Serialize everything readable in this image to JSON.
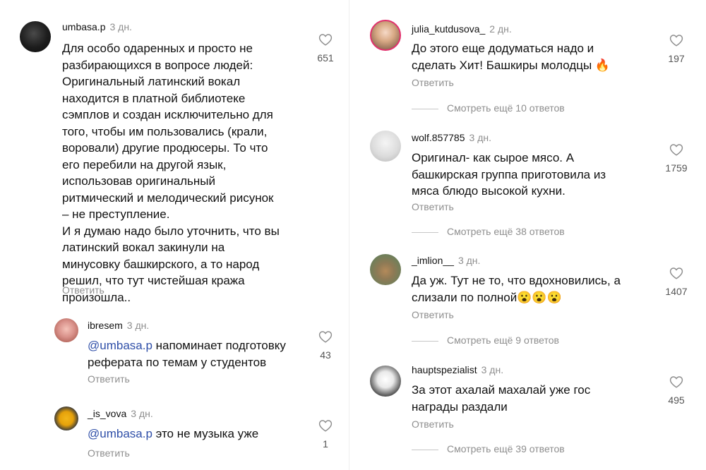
{
  "left": {
    "main": {
      "username": "umbasa.p",
      "time": "3 дн.",
      "lines": [
        "Для особо одаренных и просто не",
        "разбирающихся в вопросе людей:",
        "Оригинальный латинский вокал",
        "находится в платной библиотеке",
        "сэмплов и создан исключительно для",
        "того, чтобы им пользовались (крали,",
        "воровали) другие продюсеры. То что",
        "его перебили на другой язык,",
        "использовав оригинальный",
        "ритмический и мелодический рисунок",
        "– не преступление.",
        "И я думаю надо было уточнить, что вы",
        "латинский вокал закинули на",
        "минусовку башкирского, а то народ",
        "решил, что тут чистейшая кража",
        "произошла.."
      ],
      "reply_label": "Ответить",
      "likes": "651"
    },
    "reply1": {
      "username": "ibresem",
      "time": "3 дн.",
      "mention": "@umbasa.p",
      "line1_rest": " напоминает подготовку",
      "line2": "реферата по темам у студентов",
      "reply_label": "Ответить",
      "likes": "43"
    },
    "reply2": {
      "username": "_is_vova",
      "time": "3 дн.",
      "mention": "@umbasa.p",
      "line1_rest": " это не музыка уже",
      "reply_label": "Ответить",
      "likes": "1"
    }
  },
  "right": {
    "c1": {
      "username": "julia_kutdusova_",
      "time": "2 дн.",
      "line1": "До этого еще додуматься надо и",
      "line2": "сделать Хит! Башкиры молодцы 🔥",
      "reply_label": "Ответить",
      "likes": "197",
      "more": "Смотреть ещё 10 ответов"
    },
    "c2": {
      "username": "wolf.857785",
      "time": "3 дн.",
      "line1": "Оригинал- как сырое мясо. А",
      "line2": "башкирская  группа приготовила из",
      "line3": "мяса блюдо высокой кухни.",
      "reply_label": "Ответить",
      "likes": "1759",
      "more": "Смотреть ещё 38 ответов"
    },
    "c3": {
      "username": "_imlion__",
      "time": "3 дн.",
      "line1": "Да уж. Тут не то, что вдохновились, а",
      "line2": "слизали по полной😮😮😮",
      "reply_label": "Ответить",
      "likes": "1407",
      "more": "Смотреть ещё 9 ответов"
    },
    "c4": {
      "username": "hauptspezialist",
      "time": "3 дн.",
      "line1": "За этот ахалай махалай уже гос",
      "line2": "награды раздали",
      "reply_label": "Ответить",
      "likes": "495",
      "more": "Смотреть ещё 39 ответов"
    }
  },
  "icons": {
    "like": "heart-outline-icon"
  },
  "colors": {
    "mention": "#2f4fa8",
    "meta": "#8e8e8e"
  }
}
